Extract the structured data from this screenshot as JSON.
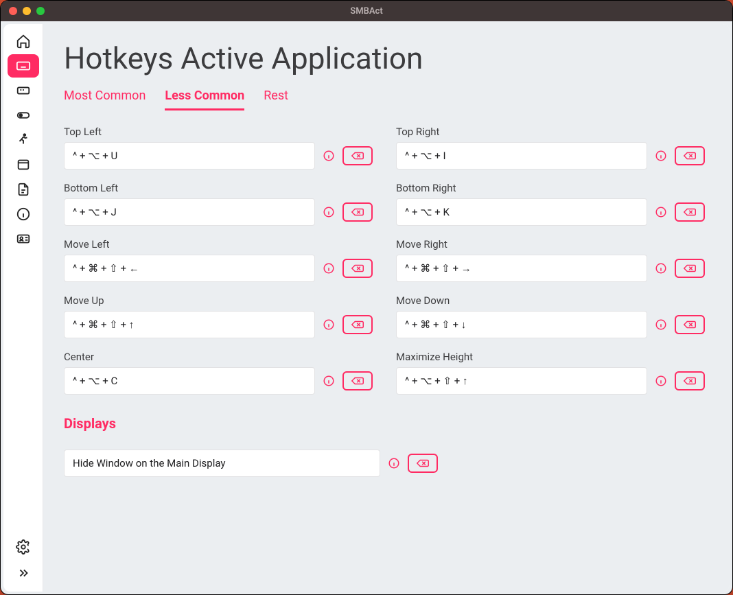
{
  "window": {
    "title": "SMBAct"
  },
  "page": {
    "title": "Hotkeys Active Application"
  },
  "tabs": {
    "most_common": "Most Common",
    "less_common": "Less Common",
    "rest": "Rest",
    "active": "less_common"
  },
  "hotkeys": [
    {
      "id": "top-left",
      "label": "Top Left",
      "value": "^ + ⌥ + U"
    },
    {
      "id": "top-right",
      "label": "Top Right",
      "value": "^ + ⌥ + I"
    },
    {
      "id": "bottom-left",
      "label": "Bottom Left",
      "value": "^ + ⌥ + J"
    },
    {
      "id": "bottom-right",
      "label": "Bottom Right",
      "value": "^ + ⌥ + K"
    },
    {
      "id": "move-left",
      "label": "Move Left",
      "value": "^ + ⌘ + ⇧ + ←"
    },
    {
      "id": "move-right",
      "label": "Move Right",
      "value": "^ + ⌘ + ⇧ + →"
    },
    {
      "id": "move-up",
      "label": "Move Up",
      "value": "^ + ⌘ + ⇧ + ↑"
    },
    {
      "id": "move-down",
      "label": "Move Down",
      "value": "^ + ⌘ + ⇧ + ↓"
    },
    {
      "id": "center",
      "label": "Center",
      "value": "^ + ⌥ + C"
    },
    {
      "id": "maximize-height",
      "label": "Maximize Height",
      "value": "^ + ⌥ + ⇧ + ↑"
    }
  ],
  "sections": {
    "displays": "Displays"
  },
  "display_action": {
    "value": "Hide Window on the Main Display"
  },
  "sidebar": {
    "items": [
      "home",
      "keyboard",
      "rename",
      "toggle",
      "running",
      "window",
      "file",
      "info",
      "id-card"
    ],
    "active": "keyboard"
  },
  "colors": {
    "accent": "#ff2b63"
  }
}
